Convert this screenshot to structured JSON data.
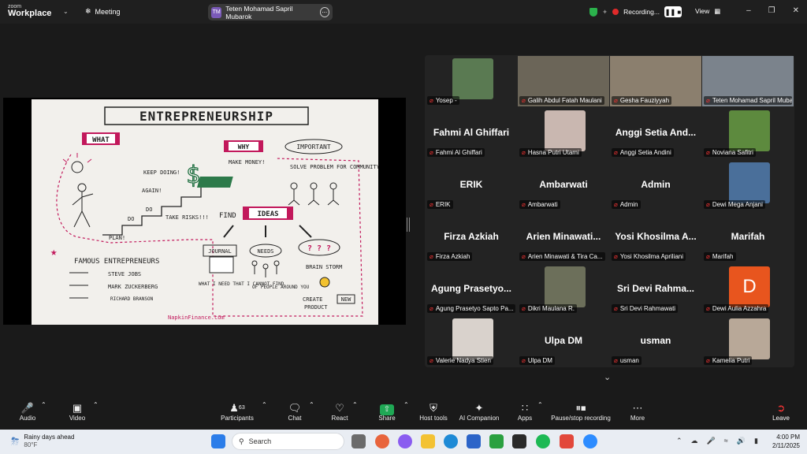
{
  "app": {
    "brand_small": "zoom",
    "brand_big": "Workplace",
    "meeting_label": "Meeting"
  },
  "speaker": {
    "initials": "TM",
    "name": "Teten Mohamad Sapril Mubarok"
  },
  "recording": {
    "label": "Recording...",
    "view_label": "View"
  },
  "participants_tiles": [
    {
      "label": "Yosep -",
      "type": "photo",
      "color": "#5a7a52"
    },
    {
      "label": "Galih Abdul Fatah Maulani",
      "type": "video",
      "color": "#6b6558"
    },
    {
      "label": "Gesha Fauziyyah",
      "type": "video",
      "color": "#8b7f6e"
    },
    {
      "label": "Teten Mohamad Sapril Muba...",
      "type": "video",
      "color": "#7b838c",
      "active": true
    },
    {
      "label": "Fahmi Al Ghiffari",
      "name": "Fahmi Al Ghiffari",
      "type": "name"
    },
    {
      "label": "Hasna Putri Utami",
      "type": "photo",
      "color": "#c9b7b0"
    },
    {
      "label": "Anggi Setia Andini",
      "name": "Anggi Setia And...",
      "type": "name"
    },
    {
      "label": "Noviana Safitri",
      "type": "photo",
      "color": "#5d8a3e"
    },
    {
      "label": "ERIK",
      "name": "ERIK",
      "type": "name"
    },
    {
      "label": "Ambarwati",
      "name": "Ambarwati",
      "type": "name"
    },
    {
      "label": "Admin",
      "name": "Admin",
      "type": "name"
    },
    {
      "label": "Dewi Mega Anjani",
      "type": "photo",
      "color": "#4a6f9a"
    },
    {
      "label": "Firza Azkiah",
      "name": "Firza Azkiah",
      "type": "name"
    },
    {
      "label": "Arien Minawati & Tira Ca...",
      "name": "Arien Minawati...",
      "type": "name"
    },
    {
      "label": "Yosi Khosilma Apriliani",
      "name": "Yosi Khosilma A...",
      "type": "name"
    },
    {
      "label": "Marifah",
      "name": "Marifah",
      "type": "name"
    },
    {
      "label": "Agung Prasetyo Sapto Pa...",
      "name": "Agung Prasetyo...",
      "type": "name"
    },
    {
      "label": "Dikri Maulana R.",
      "type": "photo",
      "color": "#6c6f5a"
    },
    {
      "label": "Sri Devi Rahmawati",
      "name": "Sri Devi Rahma...",
      "type": "name"
    },
    {
      "label": "Dewi Aulia Azzahra",
      "type": "avatar",
      "letter": "D",
      "color": "#e8551e"
    },
    {
      "label": "Valerie Nadya Stien",
      "type": "photo",
      "color": "#d9d2cc"
    },
    {
      "label": "Ulpa DM",
      "name": "Ulpa DM",
      "type": "name"
    },
    {
      "label": "usman",
      "name": "usman",
      "type": "name"
    },
    {
      "label": "Kamelia Putri",
      "type": "photo",
      "color": "#b8a898"
    }
  ],
  "slide": {
    "title": "ENTREPRENEURSHIP",
    "what": "WHAT",
    "why": "WHY",
    "important": "IMPORTANT",
    "make_money": "MAKE MONEY!",
    "solve": "SOLVE PROBLEM FOR COMMUNITY",
    "keep": "KEEP DOING!",
    "again": "AGAIN!",
    "do1": "DO",
    "do2": "DO",
    "plan": "PLAN!",
    "take": "TAKE RISKS!!!",
    "find": "FIND",
    "ideas": "IDEAS",
    "journal": "JOURNAL",
    "needs": "NEEDS",
    "q": "? ? ?",
    "what_i_need": "WHAT I NEED THAT I CANNOT FIND",
    "of_people": "OF PEOPLE AROUND YOU",
    "brainstorm": "BRAIN STORM",
    "create": "CREATE",
    "new": "NEW",
    "product": "PRODUCT",
    "famous": "FAMOUS ENTREPRENEURS",
    "p1": "STEVE JOBS",
    "p2": "MARK ZUCKERBERG",
    "p3": "RICHARD BRANSON",
    "footer": "NapkinFinance.com"
  },
  "toolbar": {
    "audio": "Audio",
    "video": "Video",
    "participants": "Participants",
    "participants_count": "63",
    "chat": "Chat",
    "react": "React",
    "share": "Share",
    "host_tools": "Host tools",
    "ai": "AI Companion",
    "apps": "Apps",
    "pause": "Pause/stop recording",
    "more": "More",
    "leave": "Leave"
  },
  "taskbar": {
    "weather_title": "Rainy days ahead",
    "weather_temp": "80°F",
    "search": "Search",
    "time": "4:00 PM",
    "date": "2/11/2025"
  },
  "colors": {
    "accent_green": "#2fd56a",
    "share_green": "#1fa855",
    "rec_red": "#e02a2a",
    "slide_pink": "#c2185b"
  }
}
